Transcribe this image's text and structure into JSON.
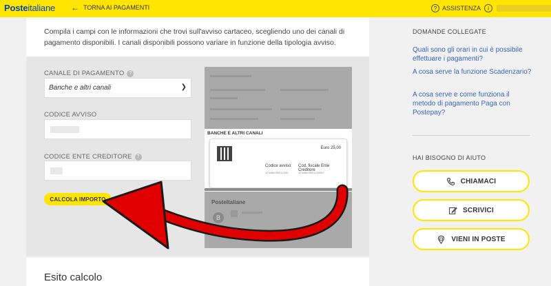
{
  "header": {
    "logo_bold": "Poste",
    "logo_rest": "italiane",
    "back_label": "TORNA AI PAGAMENTI",
    "assist_label": "ASSISTENZA"
  },
  "intro": "Compila i campi con le informazioni che trovi sull'avviso cartaceo, scegliendo uno dei canali di pagamento disponibili. I canali disponibili possono variare in funzione della tipologia avviso.",
  "form": {
    "canale_label": "CANALE DI PAGAMENTO",
    "canale_value": "Banche e altri canali",
    "codice_avviso_label": "CODICE AVVISO",
    "codice_ente_label": "CODICE ENTE CREDITORE",
    "calc_button": "CALCOLA IMPORTO"
  },
  "avviso": {
    "band_title": "BANCHE E ALTRI CANALI",
    "euro": "Euro 25,00",
    "codice_avviso": "Codice avviso",
    "codice_fiscale": "Cod. fiscale Ente Creditore",
    "digits_1": "123456789012345",
    "digits_2": "12345678901234567",
    "logo": "PosteItaliane"
  },
  "esito_title": "Esito calcolo",
  "sidebar": {
    "related_title": "DOMANDE COLLEGATE",
    "faq": [
      "Quali sono gli orari in cui è possibile effettuare i pagamenti?",
      "A cosa serve la funzione Scadenzario?",
      "A cosa serve e come funziona il metodo di pagamento Paga con Postepay?"
    ],
    "help_title": "HAI BISOGNO DI AIUTO",
    "buttons": [
      "CHIAMACI",
      "SCRIVICI",
      "VIENI IN POSTE"
    ]
  },
  "colors": {
    "brand_yellow": "#ffe500",
    "brand_blue": "#0047bb",
    "link_blue": "#3a66c4",
    "arrow_red": "#e00000"
  }
}
